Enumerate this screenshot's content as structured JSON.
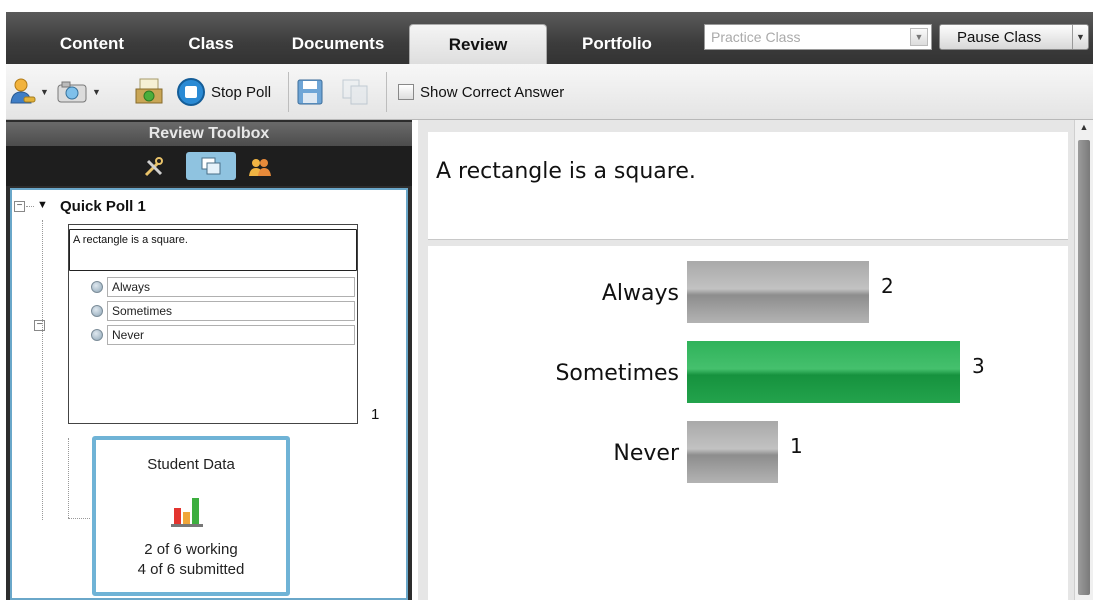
{
  "tabs": [
    {
      "label": "Content",
      "active": false
    },
    {
      "label": "Class",
      "active": false
    },
    {
      "label": "Documents",
      "active": false
    },
    {
      "label": "Review",
      "active": true
    },
    {
      "label": "Portfolio",
      "active": false
    }
  ],
  "class_selector": {
    "value": "Practice Class"
  },
  "pause_button": {
    "label": "Pause Class"
  },
  "toolbar": {
    "stop_poll_label": "Stop Poll",
    "show_correct_label": "Show Correct Answer",
    "show_correct_checked": false,
    "icons": [
      "user-icon",
      "camera-icon",
      "send-collect-icon",
      "stop-poll-icon",
      "save-icon",
      "copy-icon"
    ]
  },
  "left_panel": {
    "title": "Review Toolbox",
    "tool_icons": [
      "tools-icon",
      "pages-icon",
      "students-icon"
    ],
    "poll": {
      "title": "Quick Poll 1",
      "question": "A rectangle is a square.",
      "options": [
        "Always",
        "Sometimes",
        "Never"
      ],
      "count": "1"
    },
    "student_data": {
      "title": "Student Data",
      "working": "2 of 6 working",
      "submitted": "4 of 6 submitted"
    }
  },
  "right_panel": {
    "question": "A rectangle is a square."
  },
  "chart_data": {
    "type": "bar",
    "orientation": "horizontal",
    "categories": [
      "Always",
      "Sometimes",
      "Never"
    ],
    "values": [
      2,
      3,
      1
    ],
    "highlight_category": "Sometimes",
    "colors": {
      "default": "#8e8e8e",
      "highlight": "#1fa04a"
    },
    "title": "",
    "xlabel": "",
    "ylabel": ""
  },
  "colors": {
    "tab_bar": "#3c3c3c",
    "panel_border": "#6aa7c9",
    "correct_bar": "#1fa04a"
  }
}
